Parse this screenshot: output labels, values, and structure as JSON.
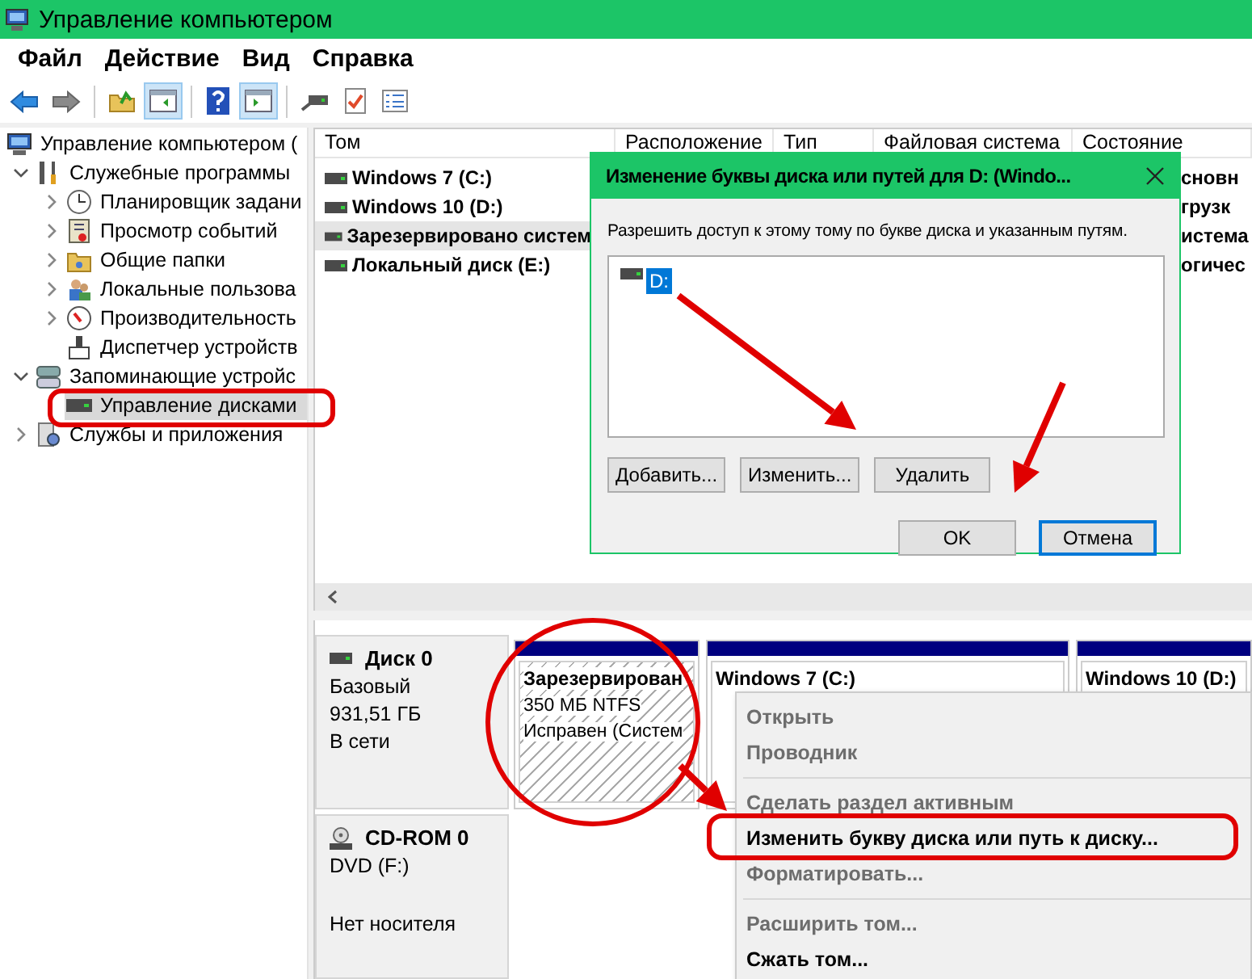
{
  "window": {
    "title": "Управление компьютером"
  },
  "menu": [
    "Файл",
    "Действие",
    "Вид",
    "Справка"
  ],
  "toolbar": [
    {
      "pressed": false
    },
    {
      "pressed": false
    },
    {
      "pressed": false
    },
    {
      "pressed": true
    },
    {
      "pressed": false
    },
    {
      "pressed": true
    },
    {
      "pressed": false
    },
    {
      "pressed": false
    },
    {
      "pressed": false
    }
  ],
  "tree": [
    {
      "label": "Управление компьютером (",
      "selected": false,
      "children": [
        {
          "label": "Служебные программы",
          "expanded": true,
          "selected": false,
          "children": [
            {
              "label": "Планировщик задани",
              "expanded": false,
              "selected": false
            },
            {
              "label": "Просмотр событий",
              "expanded": false,
              "selected": false
            },
            {
              "label": "Общие папки",
              "expanded": false,
              "selected": false
            },
            {
              "label": "Локальные пользова",
              "expanded": false,
              "selected": false
            },
            {
              "label": "Производительность",
              "expanded": false,
              "selected": false
            },
            {
              "label": "Диспетчер устройств",
              "selected": false
            }
          ]
        },
        {
          "label": "Запоминающие устройс",
          "expanded": true,
          "selected": false,
          "children": [
            {
              "label": "Управление дисками",
              "selected": true
            }
          ]
        },
        {
          "label": "Службы и приложения",
          "expanded": false,
          "selected": false
        }
      ]
    }
  ],
  "volumes": {
    "columns": [
      "Том",
      "Расположение",
      "Тип",
      "Файловая система",
      "Состояние"
    ],
    "rows": [
      {
        "name": "Windows 7 (C:)",
        "status": "сновн",
        "selected": false
      },
      {
        "name": "Windows 10 (D:)",
        "status": "грузк",
        "selected": false
      },
      {
        "name": "Зарезервировано систем",
        "status": "истема",
        "selected": true
      },
      {
        "name": "Локальный диск (E:)",
        "status": "огичес",
        "selected": false
      }
    ]
  },
  "dialog": {
    "title": "Изменение буквы диска или путей для D: (Windo...",
    "prompt": "Разрешить доступ к этому тому по букве диска и указанным путям.",
    "paths": [
      {
        "label": "D:",
        "selected": true
      }
    ],
    "buttons": [
      "Добавить...",
      "Изменить...",
      "Удалить"
    ],
    "footer_buttons": [
      {
        "label": "OK",
        "focused": false
      },
      {
        "label": "Отмена",
        "focused": true
      }
    ]
  },
  "disks": [
    {
      "kind": "basic",
      "name": "Диск 0",
      "type": "Базовый",
      "size": "931,51 ГБ",
      "status": "В сети",
      "partitions": [
        {
          "name": "Зарезервирован",
          "details": [
            "350 МБ NTFS",
            "Исправен (Систем"
          ],
          "hatched": true
        },
        {
          "name": "Windows 7 (C:)",
          "hatched": false
        },
        {
          "name": "Windows 10 (D:)",
          "hatched": false
        }
      ]
    },
    {
      "kind": "cdrom",
      "name": "CD-ROM 0",
      "type": "DVD (F:)",
      "status": "Нет носителя"
    }
  ],
  "context_menu": [
    {
      "kind": "item",
      "label": "Открыть",
      "disabled": true
    },
    {
      "kind": "item",
      "label": "Проводник",
      "disabled": true
    },
    {
      "kind": "separator"
    },
    {
      "kind": "item",
      "label": "Сделать раздел активным",
      "disabled": true
    },
    {
      "kind": "item",
      "label": "Изменить букву диска или путь к диску...",
      "disabled": false
    },
    {
      "kind": "item",
      "label": "Форматировать...",
      "disabled": true
    },
    {
      "kind": "separator"
    },
    {
      "kind": "item",
      "label": "Расширить том...",
      "disabled": true
    },
    {
      "kind": "item",
      "label": "Сжать том...",
      "disabled": false
    }
  ]
}
